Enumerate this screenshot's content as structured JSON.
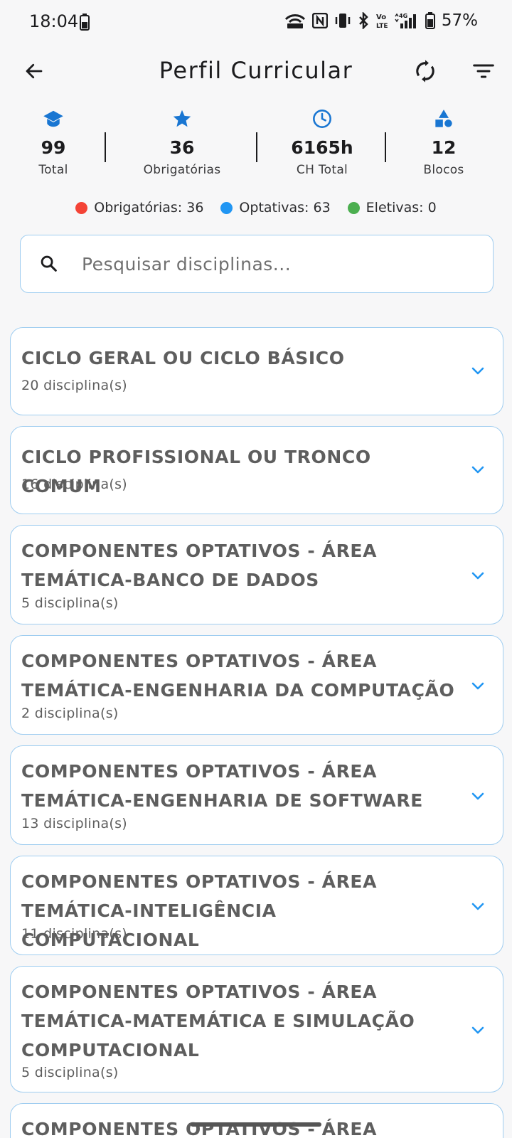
{
  "status_bar": {
    "time": "18:04",
    "battery_percent": "57%",
    "icons": [
      "battery-small-icon",
      "wifi-hotspot-icon",
      "nfc-icon",
      "vibrate-icon",
      "bluetooth-icon",
      "volte-icon",
      "signal-4g-icon",
      "battery-icon"
    ]
  },
  "app_bar": {
    "title": "Perfil Curricular",
    "back_icon": "arrow-left-icon",
    "sync_icon": "sync-icon",
    "filter_icon": "filter-icon"
  },
  "stats": [
    {
      "icon": "graduation-cap-icon",
      "value": "99",
      "label": "Total"
    },
    {
      "icon": "star-icon",
      "value": "36",
      "label": "Obrigatórias"
    },
    {
      "icon": "clock-icon",
      "value": "6165h",
      "label": "CH Total"
    },
    {
      "icon": "category-shapes-icon",
      "value": "12",
      "label": "Blocos"
    }
  ],
  "legend": [
    {
      "label": "Obrigatórias: 36",
      "color": "#f44336"
    },
    {
      "label": "Optativas: 63",
      "color": "#2196f3"
    },
    {
      "label": "Eletivas: 0",
      "color": "#4caf50"
    }
  ],
  "search": {
    "placeholder": "Pesquisar disciplinas...",
    "value": ""
  },
  "blocks": [
    {
      "title": "CICLO GERAL OU CICLO BÁSICO",
      "count": "20 disciplina(s)"
    },
    {
      "title": "CICLO PROFISSIONAL OU TRONCO COMUM",
      "count": "16 disciplina(s)"
    },
    {
      "title": "COMPONENTES OPTATIVOS  - ÁREA TEMÁTICA-BANCO DE DADOS",
      "count": "5 disciplina(s)"
    },
    {
      "title": "COMPONENTES OPTATIVOS  - ÁREA TEMÁTICA-ENGENHARIA DA COMPUTAÇÃO",
      "count": "2 disciplina(s)"
    },
    {
      "title": "COMPONENTES OPTATIVOS  - ÁREA TEMÁTICA-ENGENHARIA DE SOFTWARE",
      "count": "13 disciplina(s)"
    },
    {
      "title": "COMPONENTES OPTATIVOS  - ÁREA TEMÁTICA-INTELIGÊNCIA COMPUTACIONAL",
      "count": "11 disciplina(s)"
    },
    {
      "title": "COMPONENTES OPTATIVOS  - ÁREA TEMÁTICA-MATEMÁTICA E SIMULAÇÃO COMPUTACIONAL",
      "count": "5 disciplina(s)"
    },
    {
      "title": "COMPONENTES OPTATIVOS  - ÁREA",
      "count": ""
    }
  ],
  "colors": {
    "accent": "#1976d2",
    "card_border": "#9fcdf0",
    "chevron": "#2196f3"
  }
}
